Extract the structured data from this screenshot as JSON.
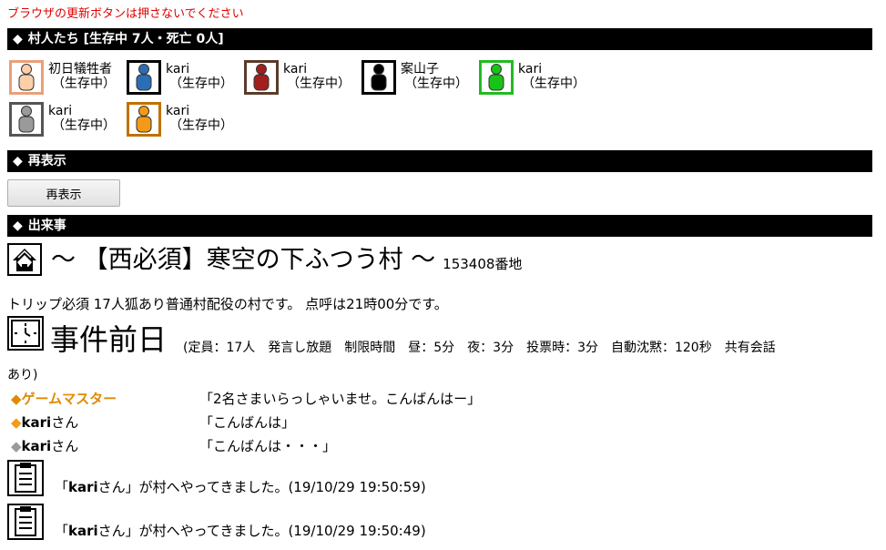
{
  "warning": "ブラウザの更新ボタンは押さないでください",
  "villagers_header": "村人たち [生存中 7人・死亡 0人]",
  "diamond": "◆",
  "players": [
    {
      "name": "初日犠牲者",
      "status": "（生存中）",
      "color": "#fbcfa9",
      "border": "#e8a07a",
      "highlight": false
    },
    {
      "name": "kari",
      "status": "（生存中）",
      "color": "#2c6eb5",
      "border": "#000000",
      "highlight": false
    },
    {
      "name": "kari",
      "status": "（生存中）",
      "color": "#a31f1f",
      "border": "#5a3b2a",
      "highlight": false
    },
    {
      "name": "案山子",
      "status": "（生存中）",
      "color": "#000000",
      "border": "#000000",
      "highlight": false
    },
    {
      "name": "kari",
      "status": "（生存中）",
      "color": "#18c318",
      "border": "#22bb22",
      "highlight": true
    },
    {
      "name": "kari",
      "status": "（生存中）",
      "color": "#9a9a9a",
      "border": "#555555",
      "highlight": false
    },
    {
      "name": "kari",
      "status": "（生存中）",
      "color": "#f59a16",
      "border": "#c07000",
      "highlight": false
    }
  ],
  "redisplay_header": "再表示",
  "redisplay_button": "再表示",
  "events_header": "出来事",
  "village": {
    "title": "～ 【西必須】寒空の下ふつう村 ～",
    "number": "153408番地",
    "description": "トリップ必須 17人狐あり普通村配役の村です。 点呼は21時00分です。"
  },
  "day": {
    "title": "事件前日",
    "options_line1": "(定員：17人　発言し放題　制限時間　昼：5分　夜：3分　投票時：3分　自動沈黙：120秒　共有会話",
    "options_line2": "あり)"
  },
  "talks": [
    {
      "who": "ゲームマスター",
      "suffix": "",
      "msg": "「2名さまいらっしゃいませ。こんばんはー」",
      "type": "gm",
      "mark_color": "#e08a00"
    },
    {
      "who": "kari",
      "suffix": "さん",
      "msg": "「こんばんは」",
      "type": "user",
      "mark_color": "#f59a16"
    },
    {
      "who": "kari",
      "suffix": "さん",
      "msg": "「こんばんは・・・」",
      "type": "user",
      "mark_color": "#9a9a9a"
    }
  ],
  "logs": [
    {
      "open": "「",
      "name": "kari",
      "suffix": "さん」が村へやってきました。(19/10/29 19:50:59)"
    },
    {
      "open": "「",
      "name": "kari",
      "suffix": "さん」が村へやってきました。(19/10/29 19:50:49)"
    }
  ]
}
